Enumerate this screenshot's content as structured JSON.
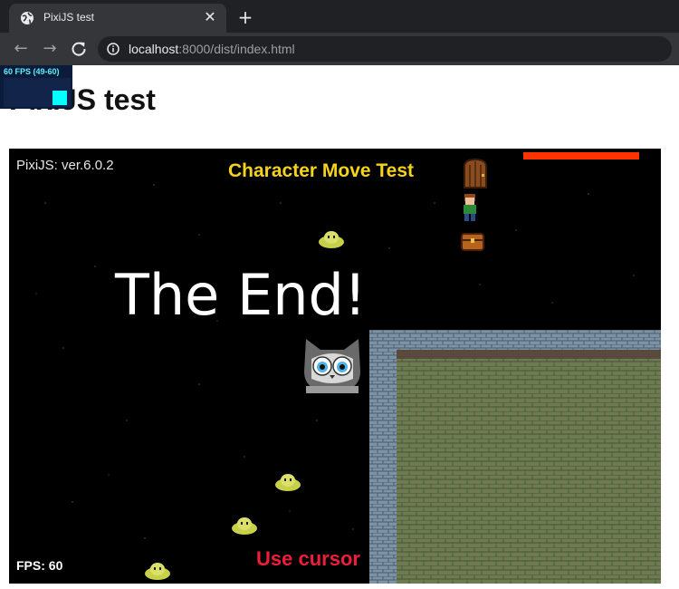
{
  "browser": {
    "tab_title": "PixiJS test",
    "url_host": "localhost",
    "url_rest": ":8000/dist/index.html"
  },
  "stats": {
    "text": "60 FPS (49-60)"
  },
  "page": {
    "title": "PixiJS test"
  },
  "game": {
    "version_text": "PixiJS: ver.6.0.2",
    "title": "Character Move Test",
    "end_text": "The End!",
    "hint_text": "Use cursor",
    "fps_text": "FPS: 60",
    "hp_color": "#ff3300",
    "title_color": "#f5d21c",
    "hint_color": "#ee1e3a"
  }
}
